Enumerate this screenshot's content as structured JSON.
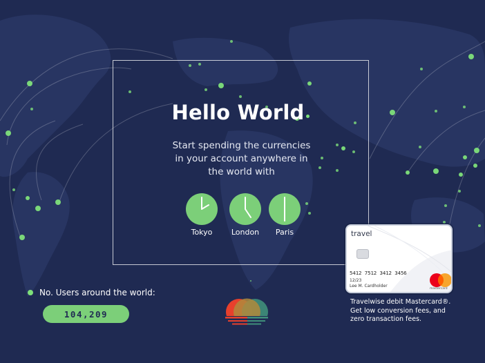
{
  "hero": {
    "title": "Hello World",
    "subtitle": "Start spending the currencies in your account anywhere in the world with"
  },
  "clocks": [
    {
      "city": "Tokyo"
    },
    {
      "city": "London"
    },
    {
      "city": "Paris"
    }
  ],
  "users": {
    "label": "No. Users around the world:",
    "count": "104,209"
  },
  "card": {
    "brand": "travel",
    "number": "5412 7512 3412 3456",
    "expiry": "12/23",
    "holder": "Lee M. Cardholder",
    "network": "mastercard",
    "caption": "Travelwise debit Mastercard®. Get low conversion fees, and zero transaction fees."
  },
  "colors": {
    "background": "#1f2a52",
    "map_land": "#283562",
    "accent_green": "#7ccf79",
    "logo_red": "#e8402c",
    "logo_teal": "#3f8f7a"
  },
  "icons": [
    "clock-icon",
    "sunrise-logo-icon",
    "mastercard-icon",
    "chip-icon"
  ]
}
